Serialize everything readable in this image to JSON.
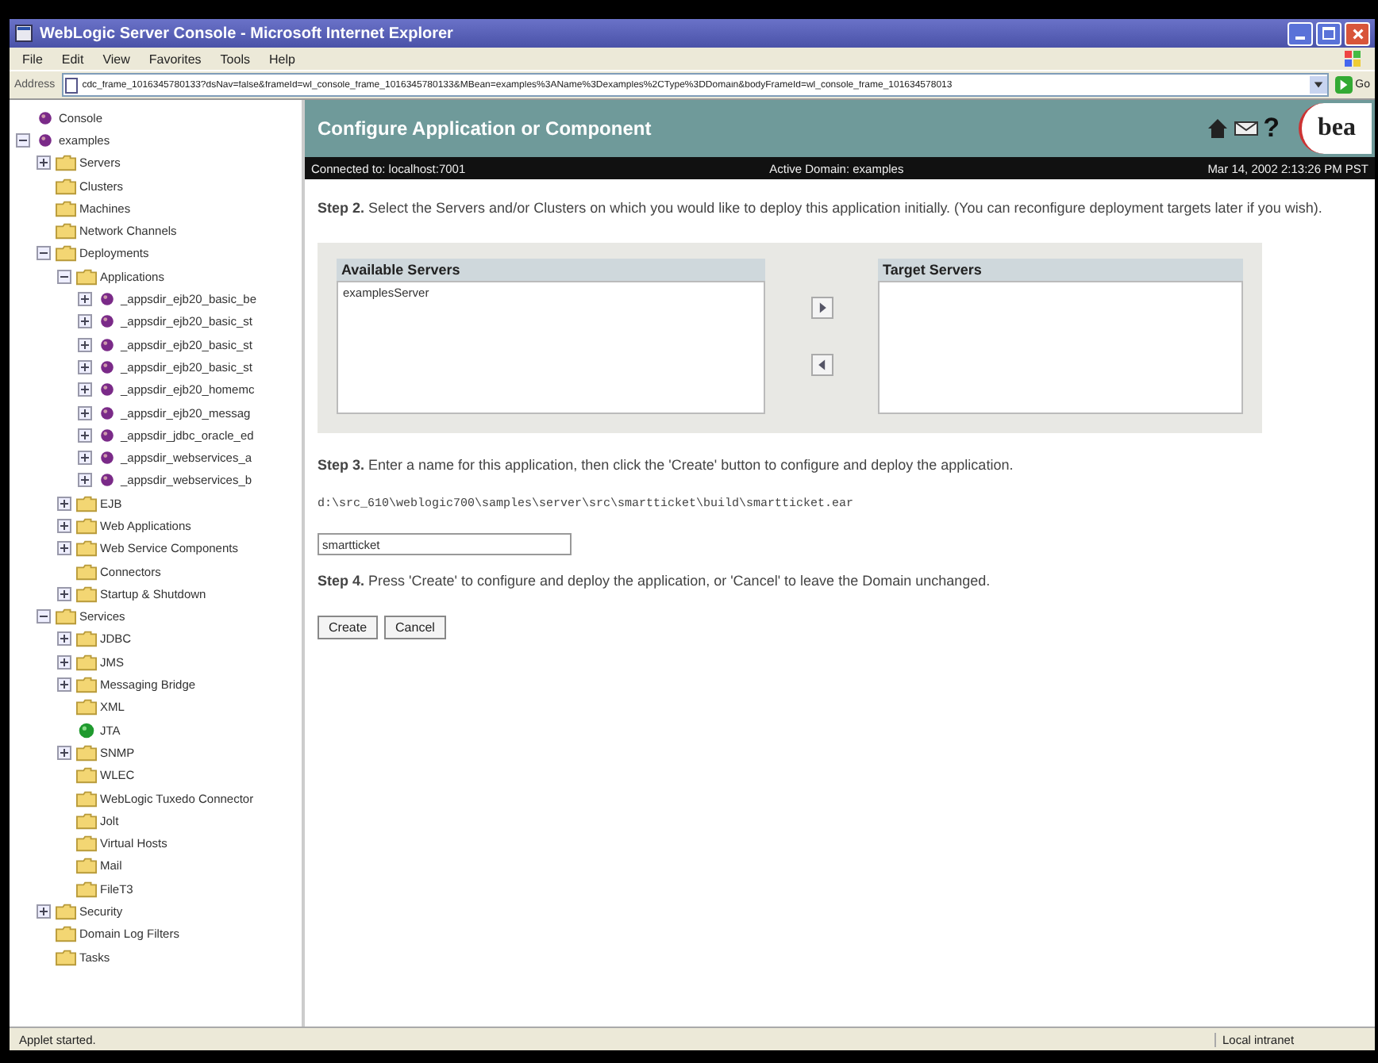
{
  "window": {
    "title": "WebLogic Server Console - Microsoft Internet Explorer"
  },
  "menu": [
    "File",
    "Edit",
    "View",
    "Favorites",
    "Tools",
    "Help"
  ],
  "address": {
    "label": "Address",
    "value": "cdc_frame_1016345780133?dsNav=false&frameId=wl_console_frame_1016345780133&MBean=examples%3AName%3Dexamples%2CType%3DDomain&bodyFrameId=wl_console_frame_101634578013",
    "go": "Go"
  },
  "tree": [
    {
      "label": "Console",
      "kind": "app"
    },
    {
      "label": "examples",
      "kind": "app",
      "expanded": true,
      "children": [
        {
          "label": "Servers",
          "kind": "folder",
          "expanded": false
        },
        {
          "label": "Clusters",
          "kind": "folder"
        },
        {
          "label": "Machines",
          "kind": "folder"
        },
        {
          "label": "Network Channels",
          "kind": "folder"
        },
        {
          "label": "Deployments",
          "kind": "folder",
          "expanded": true,
          "children": [
            {
              "label": "Applications",
              "kind": "folder",
              "expanded": true,
              "children": [
                {
                  "label": "_appsdir_ejb20_basic_be",
                  "kind": "app",
                  "expanded": false
                },
                {
                  "label": "_appsdir_ejb20_basic_st",
                  "kind": "app",
                  "expanded": false
                },
                {
                  "label": "_appsdir_ejb20_basic_st",
                  "kind": "app",
                  "expanded": false
                },
                {
                  "label": "_appsdir_ejb20_basic_st",
                  "kind": "app",
                  "expanded": false
                },
                {
                  "label": "_appsdir_ejb20_homemc",
                  "kind": "app",
                  "expanded": false
                },
                {
                  "label": "_appsdir_ejb20_messag",
                  "kind": "app",
                  "expanded": false
                },
                {
                  "label": "_appsdir_jdbc_oracle_ed",
                  "kind": "app",
                  "expanded": false
                },
                {
                  "label": "_appsdir_webservices_a",
                  "kind": "app",
                  "expanded": false
                },
                {
                  "label": "_appsdir_webservices_b",
                  "kind": "app",
                  "expanded": false
                }
              ]
            },
            {
              "label": "EJB",
              "kind": "folder",
              "expanded": false
            },
            {
              "label": "Web Applications",
              "kind": "folder",
              "expanded": false
            },
            {
              "label": "Web Service Components",
              "kind": "folder",
              "expanded": false
            },
            {
              "label": "Connectors",
              "kind": "folder"
            },
            {
              "label": "Startup & Shutdown",
              "kind": "folder",
              "expanded": false
            }
          ]
        },
        {
          "label": "Services",
          "kind": "folder",
          "expanded": true,
          "children": [
            {
              "label": "JDBC",
              "kind": "folder",
              "expanded": false
            },
            {
              "label": "JMS",
              "kind": "folder",
              "expanded": false
            },
            {
              "label": "Messaging Bridge",
              "kind": "folder",
              "expanded": false
            },
            {
              "label": "XML",
              "kind": "folder"
            },
            {
              "label": "JTA",
              "kind": "status"
            },
            {
              "label": "SNMP",
              "kind": "folder",
              "expanded": false
            },
            {
              "label": "WLEC",
              "kind": "folder"
            },
            {
              "label": "WebLogic Tuxedo Connector",
              "kind": "folder"
            },
            {
              "label": "Jolt",
              "kind": "folder"
            },
            {
              "label": "Virtual Hosts",
              "kind": "folder"
            },
            {
              "label": "Mail",
              "kind": "folder"
            },
            {
              "label": "FileT3",
              "kind": "folder"
            }
          ]
        },
        {
          "label": "Security",
          "kind": "folder",
          "expanded": false
        },
        {
          "label": "Domain Log Filters",
          "kind": "folder"
        },
        {
          "label": "Tasks",
          "kind": "folder"
        }
      ]
    }
  ],
  "header": {
    "title": "Configure Application or Component",
    "help": "?",
    "logo": "bea"
  },
  "info_bar": {
    "connected": "Connected to: localhost:7001",
    "domain": "Active Domain: examples",
    "date": "Mar 14, 2002 2:13:26 PM PST"
  },
  "step2": "**Step 2.** Select the Servers and/or Clusters on which you would like to deploy this application initially. (You can reconfigure deployment targets later if you wish).",
  "available": {
    "title": "Available Servers",
    "items": [
      "examplesServer"
    ]
  },
  "target": {
    "title": "Target Servers"
  },
  "step3": "**Step 3.** Enter a name for this application, then click the 'Create' button to configure and deploy the application.",
  "path": "d:\\src_610\\weblogic700\\samples\\server\\src\\smartticket\\build\\smartticket.ear",
  "name_value": "smartticket",
  "step4": "**Step 4.** Press 'Create' to configure and deploy the application, or 'Cancel' to leave the Domain unchanged.",
  "buttons": [
    "Create",
    "Cancel"
  ],
  "status_bar": {
    "left": "Applet started.",
    "right": "Local intranet"
  }
}
